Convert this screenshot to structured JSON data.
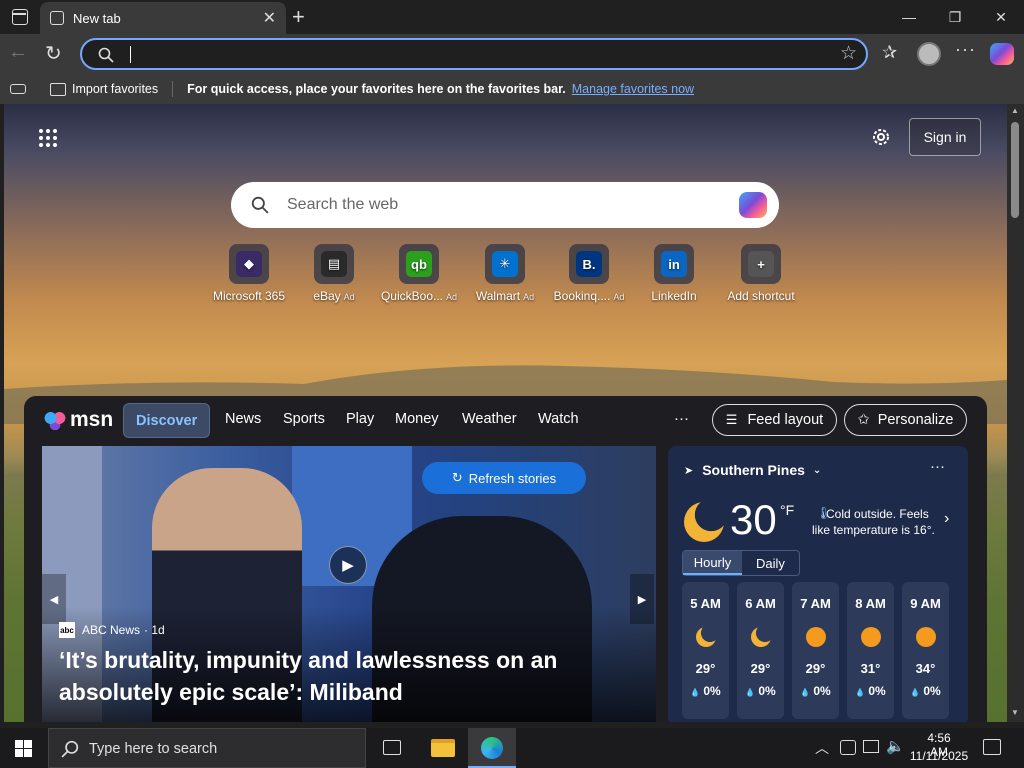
{
  "browser": {
    "tab_title": "New tab",
    "address_value": "",
    "favbar_import": "Import favorites",
    "favbar_message": "For quick access, place your favorites here on the favorites bar.",
    "favbar_manage": "Manage favorites now"
  },
  "newtab": {
    "sign_in": "Sign in",
    "search_placeholder": "Search the web",
    "shortcuts": [
      {
        "label": "Microsoft 365",
        "ad": "",
        "icon": "microsoft365-icon",
        "color": "#3a2a66"
      },
      {
        "label": "eBay",
        "ad": "Ad",
        "icon": "ebay-icon",
        "color": "#2a2a2a"
      },
      {
        "label": "QuickBoo...",
        "ad": "Ad",
        "icon": "quickbooks-icon",
        "color": "#2ca01c"
      },
      {
        "label": "Walmart",
        "ad": "Ad",
        "icon": "walmart-icon",
        "color": "#0071ce"
      },
      {
        "label": "Bookinq....",
        "ad": "Ad",
        "icon": "booking-icon",
        "color": "#003580"
      },
      {
        "label": "LinkedIn",
        "ad": "",
        "icon": "linkedin-icon",
        "color": "#0a66c2"
      },
      {
        "label": "Add shortcut",
        "ad": "",
        "icon": "plus-icon",
        "color": "#555"
      }
    ]
  },
  "msn": {
    "brand": "msn",
    "nav": [
      "Discover",
      "News",
      "Sports",
      "Play",
      "Money",
      "Weather",
      "Watch"
    ],
    "active_nav": "Discover",
    "more": "···",
    "feed_layout": "Feed layout",
    "personalize": "Personalize",
    "refresh": "Refresh stories",
    "source": "ABC News",
    "age": "· 1d",
    "headline": "‘It’s brutality, impunity and lawlessness on an absolutely epic scale’: Miliband"
  },
  "weather": {
    "location": "Southern Pines",
    "temp": "30",
    "unit": "°F",
    "summary": "Cold outside. Feels like temperature is 16°.",
    "tabs": [
      "Hourly",
      "Daily"
    ],
    "hours": [
      {
        "time": "5 AM",
        "icon": "moon",
        "temp": "29°",
        "precip": "0%"
      },
      {
        "time": "6 AM",
        "icon": "moon",
        "temp": "29°",
        "precip": "0%"
      },
      {
        "time": "7 AM",
        "icon": "sun",
        "temp": "29°",
        "precip": "0%"
      },
      {
        "time": "8 AM",
        "icon": "sun",
        "temp": "31°",
        "precip": "0%"
      },
      {
        "time": "9 AM",
        "icon": "sun",
        "temp": "34°",
        "precip": "0%"
      }
    ]
  },
  "taskbar": {
    "search_placeholder": "Type here to search",
    "time": "4:56 AM",
    "date": "11/11/2025"
  }
}
